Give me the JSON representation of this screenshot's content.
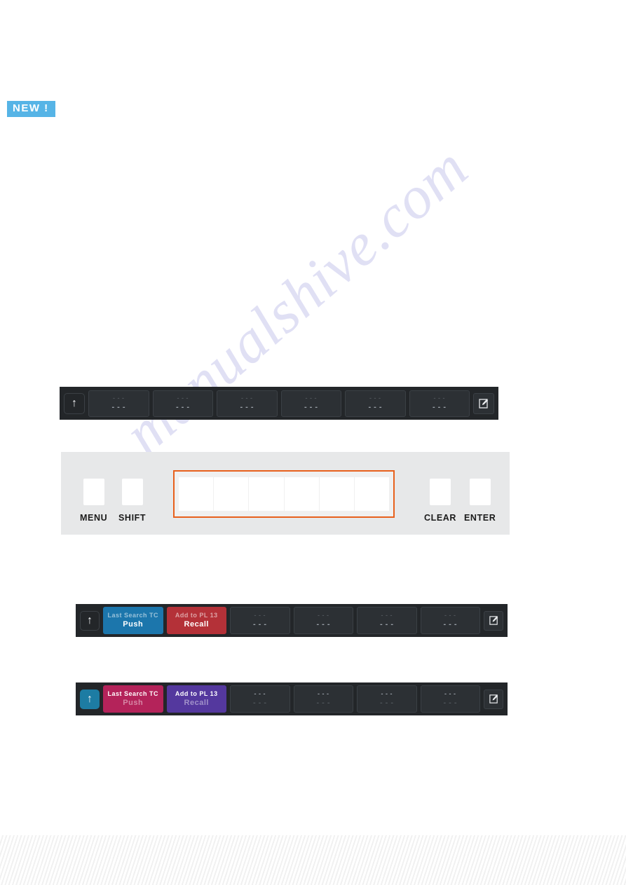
{
  "badge": {
    "label": "NEW !",
    "color": "#56b4e6"
  },
  "watermark": {
    "text": "manualshive.com"
  },
  "icons": {
    "arrow_up": "arrow-up-icon",
    "edit": "edit-pencil-icon"
  },
  "dash_placeholder": "- - -",
  "strips": [
    {
      "id": "strip-1",
      "name": "softkey-bar-empty",
      "arrow": {
        "label": "↑",
        "state": "plain"
      },
      "cells": [
        {
          "top": "- - -",
          "bottom": "- - -",
          "style": "empty"
        },
        {
          "top": "- - -",
          "bottom": "- - -",
          "style": "empty"
        },
        {
          "top": "- - -",
          "bottom": "- - -",
          "style": "empty"
        },
        {
          "top": "- - -",
          "bottom": "- - -",
          "style": "empty"
        },
        {
          "top": "- - -",
          "bottom": "- - -",
          "style": "empty"
        },
        {
          "top": "- - -",
          "bottom": "- - -",
          "style": "empty"
        }
      ],
      "edit_button": "edit-pencil-icon"
    },
    {
      "id": "strip-3",
      "name": "softkey-bar-assigned-push-recall",
      "arrow": {
        "label": "↑",
        "state": "plain"
      },
      "cells": [
        {
          "top": "Last Search TC",
          "bottom": "Push",
          "style": "blue"
        },
        {
          "top": "Add to PL 13",
          "bottom": "Recall",
          "style": "red"
        },
        {
          "top": "- - -",
          "bottom": "- - -",
          "style": "empty"
        },
        {
          "top": "- - -",
          "bottom": "- - -",
          "style": "empty"
        },
        {
          "top": "- - -",
          "bottom": "- - -",
          "style": "empty"
        },
        {
          "top": "- - -",
          "bottom": "- - -",
          "style": "empty"
        }
      ],
      "edit_button": "edit-pencil-icon"
    },
    {
      "id": "strip-4",
      "name": "softkey-bar-assigned-alt",
      "arrow": {
        "label": "↑",
        "state": "teal"
      },
      "cells": [
        {
          "top": "Last Search TC",
          "bottom": "Push",
          "style": "crimson"
        },
        {
          "top": "Add to PL 13",
          "bottom": "Recall",
          "style": "purple"
        },
        {
          "top": "- - -",
          "bottom": "- - -",
          "style": "empty"
        },
        {
          "top": "- - -",
          "bottom": "- - -",
          "style": "empty"
        },
        {
          "top": "- - -",
          "bottom": "- - -",
          "style": "empty"
        },
        {
          "top": "- - -",
          "bottom": "- - -",
          "style": "empty"
        }
      ],
      "edit_button": "edit-pencil-icon"
    }
  ],
  "keypad": {
    "menu_label": "MENU",
    "shift_label": "SHIFT",
    "clear_label": "CLEAR",
    "enter_label": "ENTER",
    "highlight_color": "#e8601c",
    "numeric_keys": [
      "",
      "",
      "",
      "",
      "",
      ""
    ]
  }
}
